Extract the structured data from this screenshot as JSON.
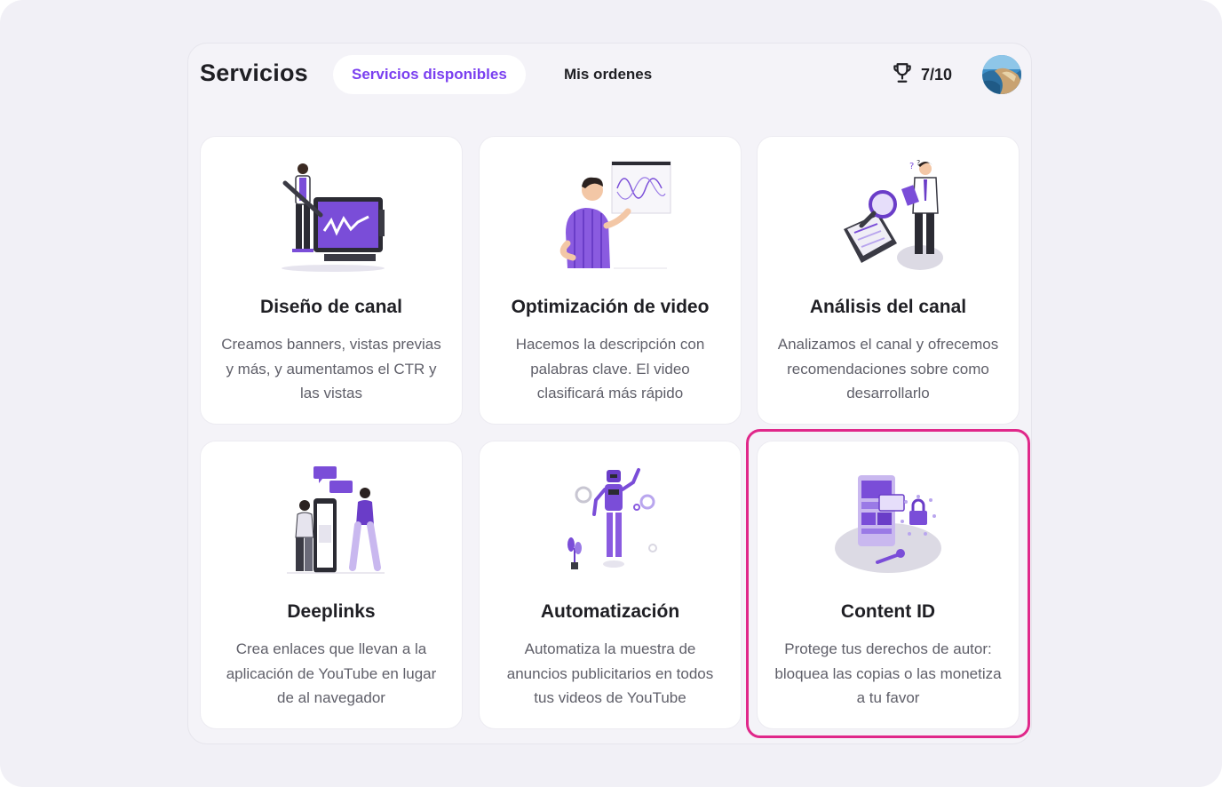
{
  "header": {
    "title": "Servicios",
    "tabs": [
      {
        "label": "Servicios disponibles",
        "active": true
      },
      {
        "label": "Mis ordenes",
        "active": false
      }
    ],
    "score": "7/10",
    "trophy_icon": "trophy-icon",
    "accent_color": "#7a3ff0"
  },
  "cards": [
    {
      "title": "Diseño de canal",
      "description": "Creamos banners, vistas previas y más, y aumentamos el CTR y las vistas",
      "icon": "design-illustration"
    },
    {
      "title": "Optimización de video",
      "description": "Hacemos la descripción con palabras clave. El video clasificará más rápido",
      "icon": "optimization-illustration"
    },
    {
      "title": "Análisis del canal",
      "description": "Analizamos el canal y ofrecemos recomendaciones sobre como desarrollarlo",
      "icon": "analysis-illustration"
    },
    {
      "title": "Deeplinks",
      "description": "Crea enlaces que llevan a la aplicación de YouTube en lugar de al navegador",
      "icon": "deeplinks-illustration"
    },
    {
      "title": "Automatización",
      "description": "Automatiza la muestra de anuncios publicitarios en todos tus videos de YouTube",
      "icon": "automation-illustration"
    },
    {
      "title": "Content ID",
      "description": "Protege tus derechos de autor: bloquea las copias o las monetiza a tu favor",
      "icon": "content-id-illustration",
      "highlighted": true
    }
  ],
  "highlight_color": "#e0288a"
}
